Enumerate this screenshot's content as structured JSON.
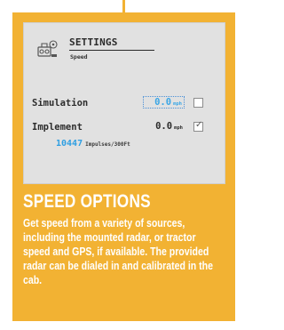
{
  "screen": {
    "title": "SETTINGS",
    "subtitle": "Speed",
    "settings_icon": "gear-screen-icon",
    "rows": [
      {
        "label": "Simulation",
        "value": "0.0",
        "unit": "mph",
        "checked": false,
        "focused": true
      },
      {
        "label": "Implement",
        "value": "0.0",
        "unit": "mph",
        "checked": true,
        "focused": false
      }
    ],
    "impulses": {
      "value": "10447",
      "unit": "Impulses/300Ft"
    }
  },
  "info": {
    "heading": "SPEED OPTIONS",
    "body": "Get speed from a variety of sources, including the mounted radar, or tractor speed and GPS, if available. The provided radar can be dialed in and calibrated in the cab."
  },
  "colors": {
    "card": "#f2b233",
    "screen": "#e1e1e1",
    "value_blue": "#3aa6e6",
    "text_dark": "#2b2b2b"
  }
}
